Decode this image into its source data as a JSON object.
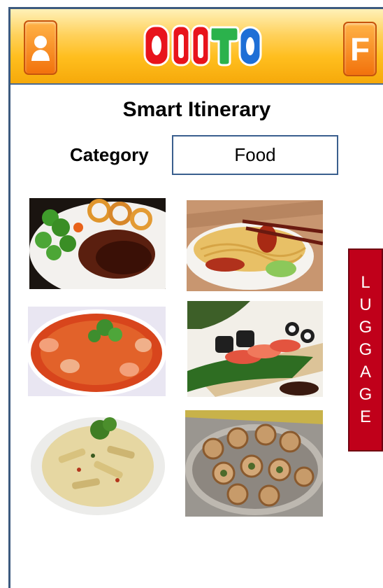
{
  "header": {
    "left_button_icon": "user-profile-icon",
    "logo_text": "QIITO",
    "right_button_label": "F",
    "colors": {
      "bar": "#ffc02a",
      "button": "#f57f12"
    }
  },
  "page": {
    "title": "Smart Itinerary"
  },
  "category": {
    "label": "Category",
    "value": "Food"
  },
  "food_items": [
    {
      "icon": "steak-onion-rings-photo"
    },
    {
      "icon": "noodles-roast-duck-photo"
    },
    {
      "icon": "tom-yum-soup-photo"
    },
    {
      "icon": "sushi-platter-photo"
    },
    {
      "icon": "pasta-penne-photo"
    },
    {
      "icon": "escargots-photo"
    }
  ],
  "luggage": {
    "letters": [
      "L",
      "U",
      "G",
      "G",
      "A",
      "G",
      "E"
    ],
    "color": "#c0001a"
  }
}
